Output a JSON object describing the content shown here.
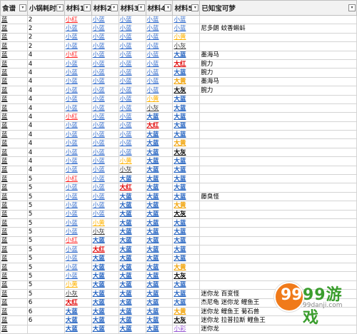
{
  "headers": {
    "recipe": "食谱",
    "time": "小锅耗时",
    "m1": "材料1",
    "m2": "材料2",
    "m3": "材料3",
    "m4": "材料4",
    "m5": "材料5",
    "dream": "已知宝可梦"
  },
  "rows": [
    {
      "recipe": "蓝",
      "time": "2",
      "m": [
        [
          "小红",
          "c-red"
        ],
        [
          "小蓝",
          "c-blue"
        ],
        [
          "小蓝",
          "c-blue"
        ],
        [
          "小蓝",
          "c-blue"
        ],
        [
          "小蓝",
          "c-blue"
        ]
      ],
      "dream": ""
    },
    {
      "recipe": "蓝",
      "time": "2",
      "m": [
        [
          "小蓝",
          "c-blue"
        ],
        [
          "小蓝",
          "c-blue"
        ],
        [
          "小蓝",
          "c-blue"
        ],
        [
          "小蓝",
          "c-blue"
        ],
        [
          "小蓝",
          "c-blue"
        ]
      ],
      "dream": "尼多朗 蚊香蝌蚪"
    },
    {
      "recipe": "蓝",
      "time": "2",
      "m": [
        [
          "小蓝",
          "c-blue"
        ],
        [
          "小蓝",
          "c-blue"
        ],
        [
          "小蓝",
          "c-blue"
        ],
        [
          "小蓝",
          "c-blue"
        ],
        [
          "小黄",
          "c-yellow"
        ]
      ],
      "dream": ""
    },
    {
      "recipe": "蓝",
      "time": "2",
      "m": [
        [
          "小蓝",
          "c-blue"
        ],
        [
          "小蓝",
          "c-blue"
        ],
        [
          "小蓝",
          "c-blue"
        ],
        [
          "小蓝",
          "c-blue"
        ],
        [
          "小灰",
          "c-gray"
        ]
      ],
      "dream": ""
    },
    {
      "recipe": "蓝",
      "time": "4",
      "m": [
        [
          "小红",
          "c-red"
        ],
        [
          "小蓝",
          "c-blue"
        ],
        [
          "小蓝",
          "c-blue"
        ],
        [
          "小蓝",
          "c-blue"
        ],
        [
          "大蓝",
          "c-bigblue"
        ]
      ],
      "dream": "墨海马"
    },
    {
      "recipe": "蓝",
      "time": "4",
      "m": [
        [
          "小蓝",
          "c-blue"
        ],
        [
          "小蓝",
          "c-blue"
        ],
        [
          "小蓝",
          "c-blue"
        ],
        [
          "小蓝",
          "c-blue"
        ],
        [
          "大红",
          "c-bigred"
        ]
      ],
      "dream": "腕力"
    },
    {
      "recipe": "蓝",
      "time": "4",
      "m": [
        [
          "小蓝",
          "c-blue"
        ],
        [
          "小蓝",
          "c-blue"
        ],
        [
          "小蓝",
          "c-blue"
        ],
        [
          "小蓝",
          "c-blue"
        ],
        [
          "大蓝",
          "c-bigblue"
        ]
      ],
      "dream": "腕力"
    },
    {
      "recipe": "蓝",
      "time": "4",
      "m": [
        [
          "小蓝",
          "c-blue"
        ],
        [
          "小蓝",
          "c-blue"
        ],
        [
          "小蓝",
          "c-blue"
        ],
        [
          "小蓝",
          "c-blue"
        ],
        [
          "大黄",
          "c-bigyellow"
        ]
      ],
      "dream": "墨海马"
    },
    {
      "recipe": "蓝",
      "time": "4",
      "m": [
        [
          "小蓝",
          "c-blue"
        ],
        [
          "小蓝",
          "c-blue"
        ],
        [
          "小蓝",
          "c-blue"
        ],
        [
          "小蓝",
          "c-blue"
        ],
        [
          "大灰",
          "c-bigblack"
        ]
      ],
      "dream": "腕力"
    },
    {
      "recipe": "蓝",
      "time": "4",
      "m": [
        [
          "小蓝",
          "c-blue"
        ],
        [
          "小蓝",
          "c-blue"
        ],
        [
          "小蓝",
          "c-blue"
        ],
        [
          "小黄",
          "c-yellow"
        ],
        [
          "大蓝",
          "c-bigblue"
        ]
      ],
      "dream": ""
    },
    {
      "recipe": "蓝",
      "time": "4",
      "m": [
        [
          "小蓝",
          "c-blue"
        ],
        [
          "小蓝",
          "c-blue"
        ],
        [
          "小蓝",
          "c-blue"
        ],
        [
          "小灰",
          "c-gray"
        ],
        [
          "大蓝",
          "c-bigblue"
        ]
      ],
      "dream": ""
    },
    {
      "recipe": "蓝",
      "time": "4",
      "m": [
        [
          "小红",
          "c-red"
        ],
        [
          "小蓝",
          "c-blue"
        ],
        [
          "小蓝",
          "c-blue"
        ],
        [
          "大蓝",
          "c-bigblue"
        ],
        [
          "大蓝",
          "c-bigblue"
        ]
      ],
      "dream": ""
    },
    {
      "recipe": "蓝",
      "time": "4",
      "m": [
        [
          "小蓝",
          "c-blue"
        ],
        [
          "小蓝",
          "c-blue"
        ],
        [
          "小蓝",
          "c-blue"
        ],
        [
          "大红",
          "c-bigred"
        ],
        [
          "大蓝",
          "c-bigblue"
        ]
      ],
      "dream": ""
    },
    {
      "recipe": "蓝",
      "time": "4",
      "m": [
        [
          "小蓝",
          "c-blue"
        ],
        [
          "小蓝",
          "c-blue"
        ],
        [
          "小蓝",
          "c-blue"
        ],
        [
          "大蓝",
          "c-bigblue"
        ],
        [
          "大蓝",
          "c-bigblue"
        ]
      ],
      "dream": ""
    },
    {
      "recipe": "蓝",
      "time": "4",
      "m": [
        [
          "小蓝",
          "c-blue"
        ],
        [
          "小蓝",
          "c-blue"
        ],
        [
          "小蓝",
          "c-blue"
        ],
        [
          "大蓝",
          "c-bigblue"
        ],
        [
          "大黄",
          "c-bigyellow"
        ]
      ],
      "dream": ""
    },
    {
      "recipe": "蓝",
      "time": "4",
      "m": [
        [
          "小蓝",
          "c-blue"
        ],
        [
          "小蓝",
          "c-blue"
        ],
        [
          "小蓝",
          "c-blue"
        ],
        [
          "大蓝",
          "c-bigblue"
        ],
        [
          "大灰",
          "c-bigblack"
        ]
      ],
      "dream": ""
    },
    {
      "recipe": "蓝",
      "time": "4",
      "m": [
        [
          "小蓝",
          "c-blue"
        ],
        [
          "小蓝",
          "c-blue"
        ],
        [
          "小黄",
          "c-yellow"
        ],
        [
          "大蓝",
          "c-bigblue"
        ],
        [
          "大蓝",
          "c-bigblue"
        ]
      ],
      "dream": ""
    },
    {
      "recipe": "蓝",
      "time": "4",
      "m": [
        [
          "小蓝",
          "c-blue"
        ],
        [
          "小蓝",
          "c-blue"
        ],
        [
          "小灰",
          "c-gray"
        ],
        [
          "大蓝",
          "c-bigblue"
        ],
        [
          "大蓝",
          "c-bigblue"
        ]
      ],
      "dream": ""
    },
    {
      "recipe": "蓝",
      "time": "5",
      "m": [
        [
          "小红",
          "c-red"
        ],
        [
          "小蓝",
          "c-blue"
        ],
        [
          "大蓝",
          "c-bigblue"
        ],
        [
          "大蓝",
          "c-bigblue"
        ],
        [
          "大蓝",
          "c-bigblue"
        ]
      ],
      "dream": ""
    },
    {
      "recipe": "蓝",
      "time": "5",
      "m": [
        [
          "小蓝",
          "c-blue"
        ],
        [
          "小蓝",
          "c-blue"
        ],
        [
          "大红",
          "c-bigred"
        ],
        [
          "大蓝",
          "c-bigblue"
        ],
        [
          "大蓝",
          "c-bigblue"
        ]
      ],
      "dream": ""
    },
    {
      "recipe": "蓝",
      "time": "5",
      "m": [
        [
          "小蓝",
          "c-blue"
        ],
        [
          "小蓝",
          "c-blue"
        ],
        [
          "大蓝",
          "c-bigblue"
        ],
        [
          "大蓝",
          "c-bigblue"
        ],
        [
          "大蓝",
          "c-bigblue"
        ]
      ],
      "dream": "藤臭怪"
    },
    {
      "recipe": "蓝",
      "time": "5",
      "m": [
        [
          "小蓝",
          "c-blue"
        ],
        [
          "小蓝",
          "c-blue"
        ],
        [
          "大蓝",
          "c-bigblue"
        ],
        [
          "大蓝",
          "c-bigblue"
        ],
        [
          "大黄",
          "c-bigyellow"
        ]
      ],
      "dream": ""
    },
    {
      "recipe": "蓝",
      "time": "5",
      "m": [
        [
          "小蓝",
          "c-blue"
        ],
        [
          "小蓝",
          "c-blue"
        ],
        [
          "大蓝",
          "c-bigblue"
        ],
        [
          "大蓝",
          "c-bigblue"
        ],
        [
          "大灰",
          "c-bigblack"
        ]
      ],
      "dream": ""
    },
    {
      "recipe": "蓝",
      "time": "5",
      "m": [
        [
          "小蓝",
          "c-blue"
        ],
        [
          "小黄",
          "c-yellow"
        ],
        [
          "大蓝",
          "c-bigblue"
        ],
        [
          "大蓝",
          "c-bigblue"
        ],
        [
          "大蓝",
          "c-bigblue"
        ]
      ],
      "dream": ""
    },
    {
      "recipe": "蓝",
      "time": "5",
      "m": [
        [
          "小蓝",
          "c-blue"
        ],
        [
          "小灰",
          "c-gray"
        ],
        [
          "大蓝",
          "c-bigblue"
        ],
        [
          "大蓝",
          "c-bigblue"
        ],
        [
          "大蓝",
          "c-bigblue"
        ]
      ],
      "dream": ""
    },
    {
      "recipe": "蓝",
      "time": "5",
      "m": [
        [
          "小红",
          "c-red"
        ],
        [
          "大蓝",
          "c-bigblue"
        ],
        [
          "大蓝",
          "c-bigblue"
        ],
        [
          "大蓝",
          "c-bigblue"
        ],
        [
          "大蓝",
          "c-bigblue"
        ]
      ],
      "dream": ""
    },
    {
      "recipe": "蓝",
      "time": "5",
      "m": [
        [
          "小蓝",
          "c-blue"
        ],
        [
          "大红",
          "c-bigred"
        ],
        [
          "大蓝",
          "c-bigblue"
        ],
        [
          "大蓝",
          "c-bigblue"
        ],
        [
          "大蓝",
          "c-bigblue"
        ]
      ],
      "dream": ""
    },
    {
      "recipe": "蓝",
      "time": "5",
      "m": [
        [
          "小蓝",
          "c-blue"
        ],
        [
          "大蓝",
          "c-bigblue"
        ],
        [
          "大蓝",
          "c-bigblue"
        ],
        [
          "大蓝",
          "c-bigblue"
        ],
        [
          "大蓝",
          "c-bigblue"
        ]
      ],
      "dream": ""
    },
    {
      "recipe": "蓝",
      "time": "5",
      "m": [
        [
          "小蓝",
          "c-blue"
        ],
        [
          "大蓝",
          "c-bigblue"
        ],
        [
          "大蓝",
          "c-bigblue"
        ],
        [
          "大蓝",
          "c-bigblue"
        ],
        [
          "大黄",
          "c-bigyellow"
        ]
      ],
      "dream": ""
    },
    {
      "recipe": "蓝",
      "time": "5",
      "m": [
        [
          "小蓝",
          "c-blue"
        ],
        [
          "大蓝",
          "c-bigblue"
        ],
        [
          "大蓝",
          "c-bigblue"
        ],
        [
          "大蓝",
          "c-bigblue"
        ],
        [
          "大灰",
          "c-bigblack"
        ]
      ],
      "dream": ""
    },
    {
      "recipe": "蓝",
      "time": "5",
      "m": [
        [
          "小黄",
          "c-yellow"
        ],
        [
          "大蓝",
          "c-bigblue"
        ],
        [
          "大蓝",
          "c-bigblue"
        ],
        [
          "大蓝",
          "c-bigblue"
        ],
        [
          "大蓝",
          "c-bigblue"
        ]
      ],
      "dream": ""
    },
    {
      "recipe": "蓝",
      "time": "5",
      "m": [
        [
          "小灰",
          "c-gray"
        ],
        [
          "大蓝",
          "c-bigblue"
        ],
        [
          "大蓝",
          "c-bigblue"
        ],
        [
          "大蓝",
          "c-bigblue"
        ],
        [
          "大蓝",
          "c-bigblue"
        ]
      ],
      "dream": "迷你龙 百变怪"
    },
    {
      "recipe": "蓝",
      "time": "6",
      "m": [
        [
          "大红",
          "c-bigred"
        ],
        [
          "大蓝",
          "c-bigblue"
        ],
        [
          "大蓝",
          "c-bigblue"
        ],
        [
          "大蓝",
          "c-bigblue"
        ],
        [
          "大蓝",
          "c-bigblue"
        ]
      ],
      "dream": "杰尼龟 迷你龙 鲤鱼王"
    },
    {
      "recipe": "蓝",
      "time": "6",
      "m": [
        [
          "大蓝",
          "c-bigblue"
        ],
        [
          "大蓝",
          "c-bigblue"
        ],
        [
          "大蓝",
          "c-bigblue"
        ],
        [
          "大蓝",
          "c-bigblue"
        ],
        [
          "大黄",
          "c-bigyellow"
        ]
      ],
      "dream": "迷你龙 鲤鱼王 菊石兽"
    },
    {
      "recipe": "蓝",
      "time": "6",
      "m": [
        [
          "大蓝",
          "c-bigblue"
        ],
        [
          "大蓝",
          "c-bigblue"
        ],
        [
          "大蓝",
          "c-bigblue"
        ],
        [
          "大蓝",
          "c-bigblue"
        ],
        [
          "大灰",
          "c-bigblack"
        ]
      ],
      "dream": "迷你龙 拉普拉斯 鲤鱼王"
    },
    {
      "recipe": "蓝",
      "time": "",
      "m": [
        [
          "大蓝",
          "c-bigblue"
        ],
        [
          "大蓝",
          "c-bigblue"
        ],
        [
          "大蓝",
          "c-bigblue"
        ],
        [
          "大蓝",
          "c-bigblue"
        ],
        [
          "小彩",
          "c-purple"
        ]
      ],
      "dream": "迷你龙"
    }
  ],
  "watermark": {
    "digits": "99",
    "name": "99游戏",
    "url": "99danji.com"
  }
}
